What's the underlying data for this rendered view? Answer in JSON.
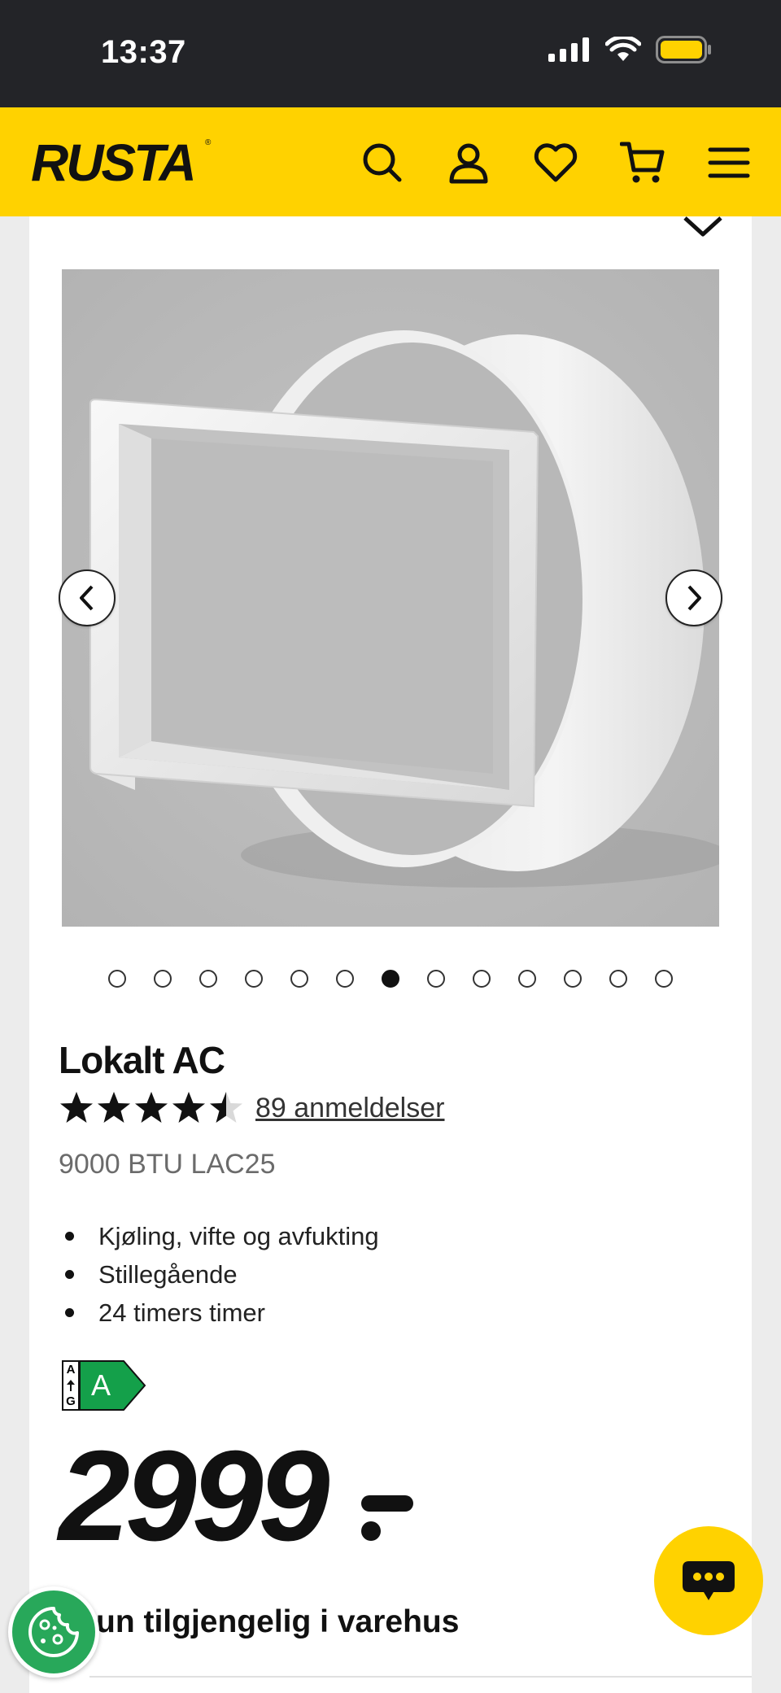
{
  "status_bar": {
    "time": "13:37"
  },
  "header": {
    "logo_text": "RUSTA",
    "brand_color": "#ffd200"
  },
  "gallery": {
    "image_alt": "Lokalt AC produktbilde",
    "dot_count": 13,
    "active_index": 6
  },
  "product": {
    "title": "Lokalt AC",
    "rating": 4.5,
    "reviews": "89 anmeldelser",
    "subtitle": "9000 BTU LAC25",
    "features": [
      "Kjøling, vifte og avfukting",
      "Stillegående",
      "24 timers timer"
    ],
    "energy_scale_top": "A",
    "energy_scale_bottom": "G",
    "energy_class": "A",
    "price": "2999",
    "availability": "un tilgjengelig i varehus"
  }
}
